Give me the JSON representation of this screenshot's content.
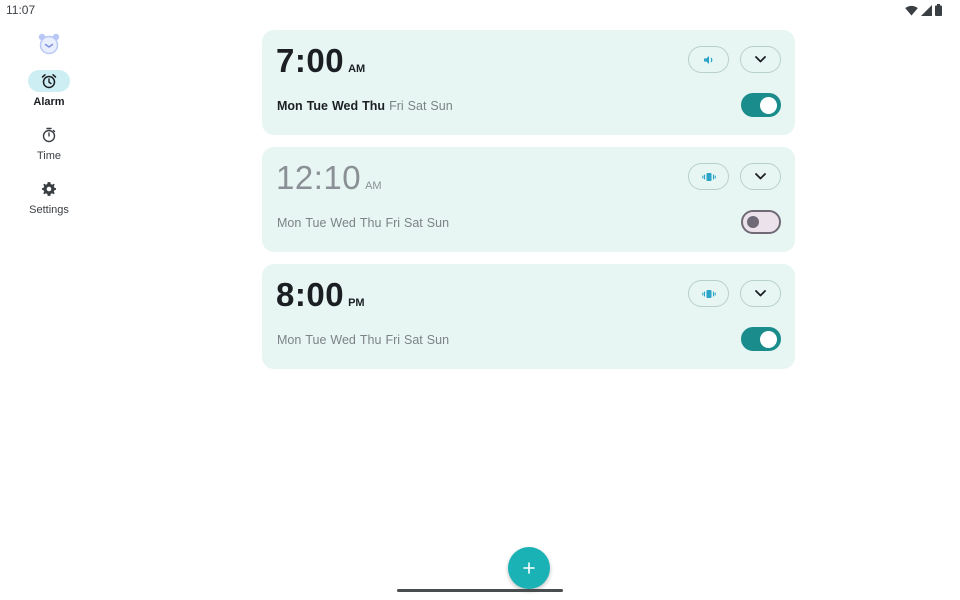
{
  "status_bar": {
    "time": "11:07",
    "icons": [
      "wifi-icon",
      "cell-signal-icon",
      "battery-icon"
    ]
  },
  "nav": {
    "items": [
      {
        "label": "Alarm",
        "icon": "alarm-clock-icon",
        "active": true
      },
      {
        "label": "Time",
        "icon": "stopwatch-icon",
        "active": false
      },
      {
        "label": "Settings",
        "icon": "gear-icon",
        "active": false
      }
    ]
  },
  "alarms": [
    {
      "time": "7:00",
      "ampm": "AM",
      "enabled": true,
      "ring_icon": "volume-icon",
      "days": [
        {
          "label": "Mon",
          "active": true
        },
        {
          "label": "Tue",
          "active": true
        },
        {
          "label": "Wed",
          "active": true
        },
        {
          "label": "Thu",
          "active": true
        },
        {
          "label": "Fri",
          "active": false
        },
        {
          "label": "Sat",
          "active": false
        },
        {
          "label": "Sun",
          "active": false
        }
      ]
    },
    {
      "time": "12:10",
      "ampm": "AM",
      "enabled": false,
      "ring_icon": "vibrate-icon",
      "days": [
        {
          "label": "Mon",
          "active": false
        },
        {
          "label": "Tue",
          "active": false
        },
        {
          "label": "Wed",
          "active": false
        },
        {
          "label": "Thu",
          "active": false
        },
        {
          "label": "Fri",
          "active": false
        },
        {
          "label": "Sat",
          "active": false
        },
        {
          "label": "Sun",
          "active": false
        }
      ]
    },
    {
      "time": "8:00",
      "ampm": "PM",
      "enabled": true,
      "ring_icon": "vibrate-icon",
      "days": [
        {
          "label": "Mon",
          "active": false
        },
        {
          "label": "Tue",
          "active": false
        },
        {
          "label": "Wed",
          "active": false
        },
        {
          "label": "Thu",
          "active": false
        },
        {
          "label": "Fri",
          "active": false
        },
        {
          "label": "Sat",
          "active": false
        },
        {
          "label": "Sun",
          "active": false
        }
      ]
    }
  ],
  "fab": {
    "icon": "plus-icon"
  },
  "colors": {
    "accent": "#1ab2b5",
    "toggle_on": "#1a8c8c",
    "card_bg": "#e7f6f3",
    "nav_active": "#cdeef2",
    "ring_icon": "#2aa4c8"
  }
}
